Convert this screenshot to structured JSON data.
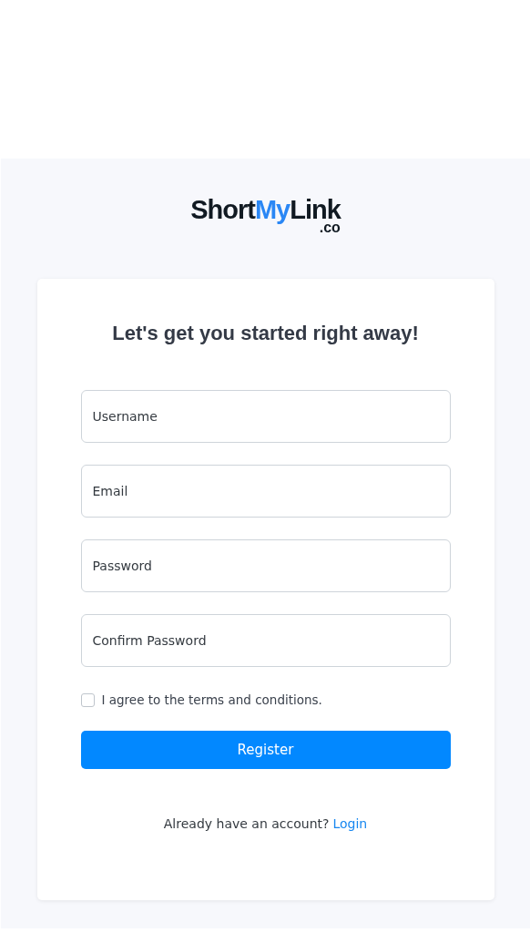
{
  "logo": {
    "parts": [
      {
        "text": "Short",
        "accent": false
      },
      {
        "text": "My",
        "accent": true
      },
      {
        "text": "Link",
        "accent": false
      }
    ],
    "suffix": ".co"
  },
  "form": {
    "title": "Let's get you started right away!",
    "fields": [
      {
        "placeholder": "Username"
      },
      {
        "placeholder": "Email"
      },
      {
        "placeholder": "Password"
      },
      {
        "placeholder": "Confirm Password"
      }
    ],
    "terms": {
      "label": "I agree to the terms and conditions.",
      "checked": false
    },
    "submit": "Register",
    "footer": {
      "text": "Already have an account?",
      "link": "Login"
    }
  }
}
